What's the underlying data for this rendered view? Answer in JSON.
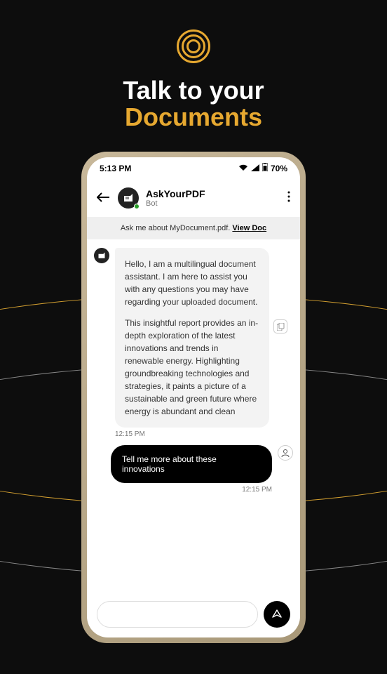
{
  "hero": {
    "line1": "Talk to your",
    "line2": "Documents"
  },
  "status_bar": {
    "time": "5:13 PM",
    "battery": "70%"
  },
  "header": {
    "title": "AskYourPDF",
    "subtitle": "Bot"
  },
  "banner": {
    "text": "Ask me about MyDocument.pdf. ",
    "link_text": "View Doc"
  },
  "bot_message": {
    "p1": "Hello, I am a multilingual document assistant. I am here to assist you with any questions you may have regarding your uploaded document.",
    "p2": "This insightful report provides an in-depth exploration of the latest innovations and trends in renewable energy. Highlighting groundbreaking technologies and strategies, it paints a picture of a sustainable and green future where energy is abundant and clean",
    "timestamp": "12:15 PM"
  },
  "user_message": {
    "text": "Tell me more about these innovations",
    "timestamp": "12:15 PM"
  },
  "input": {
    "placeholder": ""
  }
}
